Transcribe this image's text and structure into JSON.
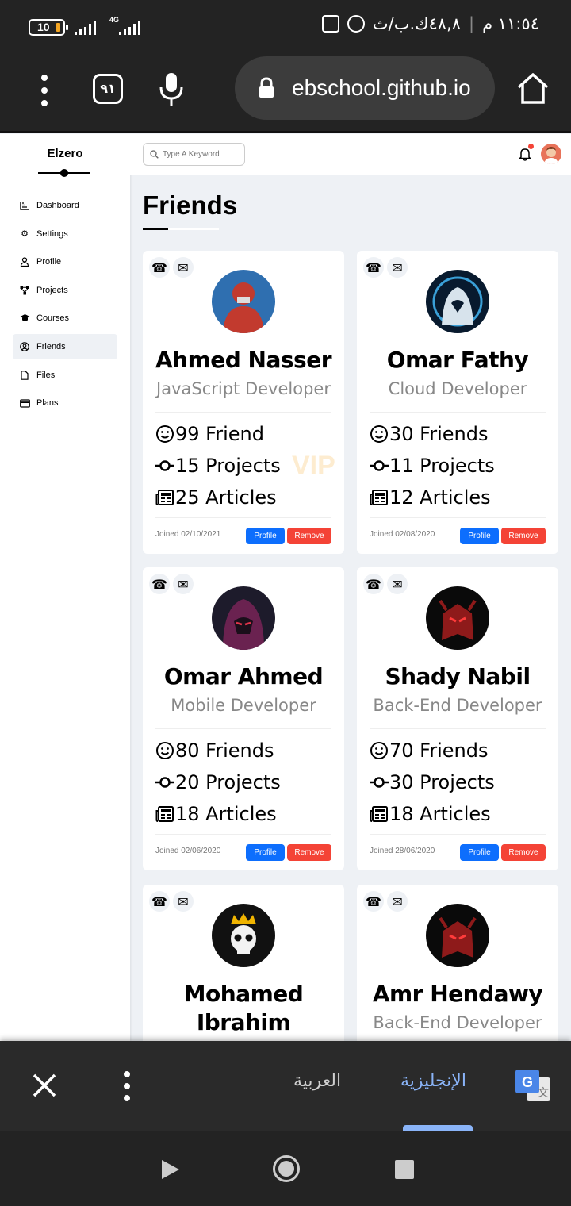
{
  "status_bar": {
    "battery": "10",
    "network_type": "4G",
    "time": "١١:٥٤ م",
    "speed": "٤٨,٨ك.ب/ث"
  },
  "browser": {
    "tabs_count": "٩١",
    "url": "ebschool.github.io"
  },
  "sidebar": {
    "brand": "Elzero",
    "items": [
      {
        "label": "Dashboard",
        "icon": "chart-icon"
      },
      {
        "label": "Settings",
        "icon": "gear-icon"
      },
      {
        "label": "Profile",
        "icon": "user-icon"
      },
      {
        "label": "Projects",
        "icon": "diagram-icon"
      },
      {
        "label": "Courses",
        "icon": "graduation-cap-icon"
      },
      {
        "label": "Friends",
        "icon": "user-circle-icon"
      },
      {
        "label": "Files",
        "icon": "file-icon"
      },
      {
        "label": "Plans",
        "icon": "credit-card-icon"
      }
    ],
    "active": "Friends"
  },
  "topbar": {
    "search_placeholder": "Type A Keyword"
  },
  "page": {
    "title": "Friends"
  },
  "friends": [
    {
      "name": "Ahmed Nasser",
      "job": "JavaScript Developer",
      "friends": "99 Friend",
      "projects": "15 Projects",
      "articles": "25 Articles",
      "joined": "Joined 02/10/2021",
      "vip": "VIP"
    },
    {
      "name": "Omar Fathy",
      "job": "Cloud Developer",
      "friends": "30 Friends",
      "projects": "11 Projects",
      "articles": "12 Articles",
      "joined": "Joined 02/08/2020"
    },
    {
      "name": "Omar Ahmed",
      "job": "Mobile Developer",
      "friends": "80 Friends",
      "projects": "20 Projects",
      "articles": "18 Articles",
      "joined": "Joined 02/06/2020"
    },
    {
      "name": "Shady Nabil",
      "job": "Back-End Developer",
      "friends": "70 Friends",
      "projects": "30 Projects",
      "articles": "18 Articles",
      "joined": "Joined 28/06/2020"
    },
    {
      "name": "Mohamed Ibrahim",
      "job": "",
      "friends": "",
      "projects": "",
      "articles": "",
      "joined": ""
    },
    {
      "name": "Amr Hendawy",
      "job": "Back-End Developer",
      "friends": "",
      "projects": "",
      "articles": "",
      "joined": ""
    }
  ],
  "buttons": {
    "profile": "Profile",
    "remove": "Remove"
  },
  "translate_bar": {
    "lang_arabic": "العربية",
    "lang_english": "الإنجليزية"
  },
  "colors": {
    "primary": "#0d6efd",
    "danger": "#f44336",
    "page_bg": "#eef1f5",
    "vip": "#fdecd0"
  }
}
